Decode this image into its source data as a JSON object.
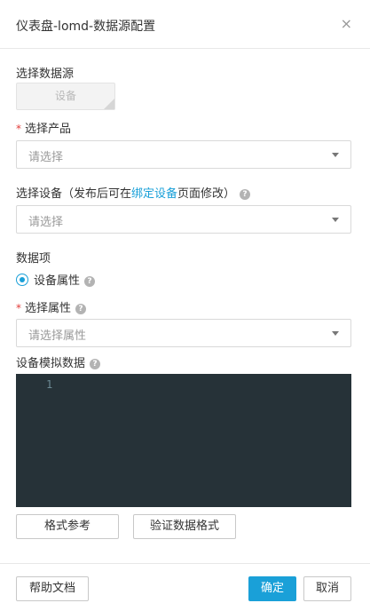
{
  "dialog": {
    "title": "仪表盘-lomd-数据源配置",
    "close_glyph": "×"
  },
  "datasource": {
    "label": "选择数据源",
    "option": "设备"
  },
  "product": {
    "required_mark": "*",
    "label": "选择产品",
    "placeholder": "请选择"
  },
  "device": {
    "label_before": "选择设备（发布后可在",
    "label_link": "绑定设备",
    "label_after": "页面修改）",
    "help_icon": "?",
    "placeholder": "请选择"
  },
  "data_item": {
    "label": "数据项",
    "radio_label": "设备属性",
    "help_icon": "?",
    "selected": true
  },
  "property": {
    "required_mark": "*",
    "label": "选择属性",
    "help_icon": "?",
    "placeholder": "请选择属性"
  },
  "mock": {
    "label": "设备模拟数据",
    "help_icon": "?",
    "line_number": "1"
  },
  "actions": {
    "format_ref": "格式参考",
    "validate": "验证数据格式"
  },
  "footer": {
    "help_doc": "帮助文档",
    "confirm": "确定",
    "cancel": "取消"
  },
  "colors": {
    "accent": "#1aa0d8",
    "required": "#e23c39",
    "editor_bg": "#263238"
  }
}
